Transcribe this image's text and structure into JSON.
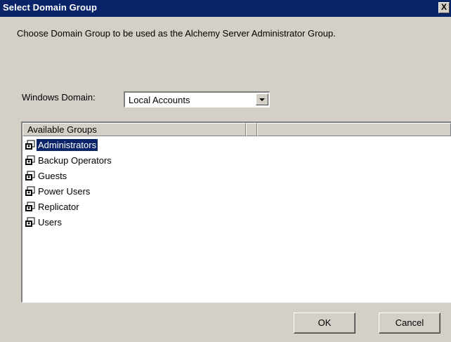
{
  "window": {
    "title": "Select Domain Group",
    "close_label": "X"
  },
  "instruction": "Choose Domain Group to be used as the Alchemy Server Administrator Group.",
  "domain": {
    "label": "Windows Domain:",
    "selected": "Local Accounts"
  },
  "list": {
    "columns": [
      "Available Groups",
      ""
    ],
    "items": [
      {
        "label": "Administrators",
        "selected": true
      },
      {
        "label": "Backup Operators",
        "selected": false
      },
      {
        "label": "Guests",
        "selected": false
      },
      {
        "label": "Power Users",
        "selected": false
      },
      {
        "label": "Replicator",
        "selected": false
      },
      {
        "label": "Users",
        "selected": false
      }
    ]
  },
  "buttons": {
    "ok": "OK",
    "cancel": "Cancel"
  },
  "colors": {
    "titlebar": "#0a246a",
    "selection": "#0a246a",
    "dialog": "#d4d0c8"
  }
}
